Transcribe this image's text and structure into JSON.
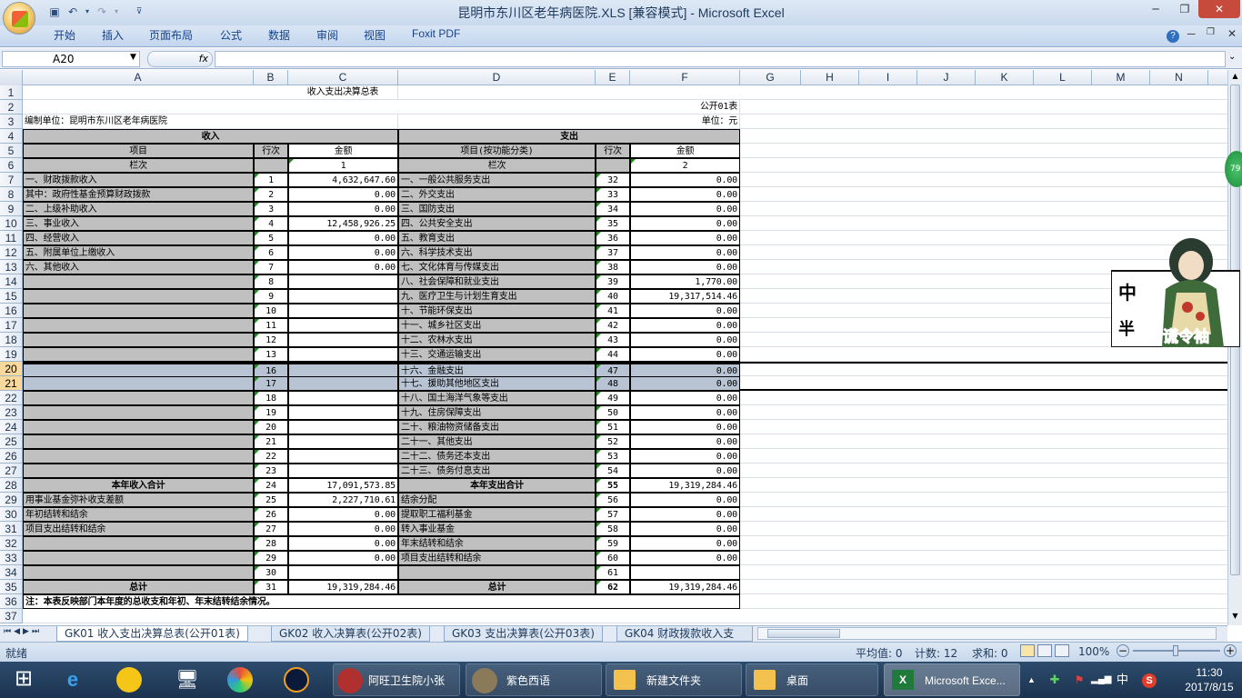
{
  "window": {
    "title": "昆明市东川区老年病医院.XLS  [兼容模式] - Microsoft Excel"
  },
  "ribbon": {
    "tabs": [
      "开始",
      "插入",
      "页面布局",
      "公式",
      "数据",
      "审阅",
      "视图",
      "Foxit PDF"
    ]
  },
  "formula_bar": {
    "name_box": "A20",
    "fx": "fx",
    "content": ""
  },
  "columns": [
    "A",
    "B",
    "C",
    "D",
    "E",
    "F",
    "G",
    "H",
    "I",
    "J",
    "K",
    "L",
    "M",
    "N"
  ],
  "sheet": {
    "title": "收入支出决算总表",
    "form_no": "公开01表",
    "unit_label": "单位：元",
    "org": "编制单位：昆明市东川区老年病医院",
    "income_header": "收入",
    "expense_header": "支出",
    "col_item": "项目",
    "col_line": "行次",
    "col_amount": "金额",
    "col_item_func": "项目(按功能分类)",
    "col_lanci": "栏次",
    "col_num1": "1",
    "col_num2": "2",
    "rows": [
      {
        "a": "一、财政拨款收入",
        "b": "1",
        "c": "4,632,647.60",
        "d": "一、一般公共服务支出",
        "e": "32",
        "f": "0.00"
      },
      {
        "a": "   其中：政府性基金预算财政拨款",
        "b": "2",
        "c": "0.00",
        "d": "二、外交支出",
        "e": "33",
        "f": "0.00"
      },
      {
        "a": "二、上级补助收入",
        "b": "3",
        "c": "0.00",
        "d": "三、国防支出",
        "e": "34",
        "f": "0.00"
      },
      {
        "a": "三、事业收入",
        "b": "4",
        "c": "12,458,926.25",
        "d": "四、公共安全支出",
        "e": "35",
        "f": "0.00"
      },
      {
        "a": "四、经营收入",
        "b": "5",
        "c": "0.00",
        "d": "五、教育支出",
        "e": "36",
        "f": "0.00"
      },
      {
        "a": "五、附属单位上缴收入",
        "b": "6",
        "c": "0.00",
        "d": "六、科学技术支出",
        "e": "37",
        "f": "0.00"
      },
      {
        "a": "六、其他收入",
        "b": "7",
        "c": "0.00",
        "d": "七、文化体育与传媒支出",
        "e": "38",
        "f": "0.00"
      },
      {
        "a": "",
        "b": "8",
        "c": "",
        "d": "八、社会保障和就业支出",
        "e": "39",
        "f": "1,770.00"
      },
      {
        "a": "",
        "b": "9",
        "c": "",
        "d": "九、医疗卫生与计划生育支出",
        "e": "40",
        "f": "19,317,514.46"
      },
      {
        "a": "",
        "b": "10",
        "c": "",
        "d": "十、节能环保支出",
        "e": "41",
        "f": "0.00"
      },
      {
        "a": "",
        "b": "11",
        "c": "",
        "d": "十一、城乡社区支出",
        "e": "42",
        "f": "0.00"
      },
      {
        "a": "",
        "b": "12",
        "c": "",
        "d": "十二、农林水支出",
        "e": "43",
        "f": "0.00"
      },
      {
        "a": "",
        "b": "13",
        "c": "",
        "d": "十三、交通运输支出",
        "e": "44",
        "f": "0.00"
      },
      {
        "a": "",
        "b": "16",
        "c": "",
        "d": "十六、金融支出",
        "e": "47",
        "f": "0.00"
      },
      {
        "a": "",
        "b": "17",
        "c": "",
        "d": "十七、援助其他地区支出",
        "e": "48",
        "f": "0.00"
      },
      {
        "a": "",
        "b": "18",
        "c": "",
        "d": "十八、国土海洋气象等支出",
        "e": "49",
        "f": "0.00"
      },
      {
        "a": "",
        "b": "19",
        "c": "",
        "d": "十九、住房保障支出",
        "e": "50",
        "f": "0.00"
      },
      {
        "a": "",
        "b": "20",
        "c": "",
        "d": "二十、粮油物资储备支出",
        "e": "51",
        "f": "0.00"
      },
      {
        "a": "",
        "b": "21",
        "c": "",
        "d": "二十一、其他支出",
        "e": "52",
        "f": "0.00"
      },
      {
        "a": "",
        "b": "22",
        "c": "",
        "d": "二十二、债务还本支出",
        "e": "53",
        "f": "0.00"
      },
      {
        "a": "",
        "b": "23",
        "c": "",
        "d": "二十三、债务付息支出",
        "e": "54",
        "f": "0.00"
      },
      {
        "a": "本年收入合计",
        "b": "24",
        "c": "17,091,573.85",
        "d": "本年支出合计",
        "e": "55",
        "f": "19,319,284.46",
        "bold": true
      },
      {
        "a": "    用事业基金弥补收支差额",
        "b": "25",
        "c": "2,227,710.61",
        "d": "     结余分配",
        "e": "56",
        "f": "0.00"
      },
      {
        "a": "    年初结转和结余",
        "b": "26",
        "c": "0.00",
        "d": "       提取职工福利基金",
        "e": "57",
        "f": "0.00"
      },
      {
        "a": "      项目支出结转和结余",
        "b": "27",
        "c": "0.00",
        "d": "       转入事业基金",
        "e": "58",
        "f": "0.00"
      },
      {
        "a": "",
        "b": "28",
        "c": "0.00",
        "d": "     年末结转和结余",
        "e": "59",
        "f": "0.00"
      },
      {
        "a": "",
        "b": "29",
        "c": "0.00",
        "d": "       项目支出结转和结余",
        "e": "60",
        "f": "0.00"
      },
      {
        "a": "",
        "b": "30",
        "c": "",
        "d": "",
        "e": "61",
        "f": ""
      },
      {
        "a": "总计",
        "b": "31",
        "c": "19,319,284.46",
        "d": "总计",
        "e": "62",
        "f": "19,319,284.46",
        "bold": true
      }
    ],
    "note": "注：本表反映部门本年度的总收支和年初、年末结转结余情况。"
  },
  "row_numbers": [
    "1",
    "2",
    "3",
    "4",
    "5",
    "6",
    "7",
    "8",
    "9",
    "10",
    "11",
    "12",
    "13",
    "14",
    "15",
    "16",
    "17",
    "18",
    "19",
    "20",
    "21",
    "22",
    "23",
    "24",
    "25",
    "26",
    "27",
    "28",
    "29",
    "30",
    "31",
    "32",
    "33",
    "34",
    "35",
    "36",
    "37"
  ],
  "sheet_tabs": [
    "GK01 收入支出决算总表(公开01表)",
    "GK02 收入决算表(公开02表)",
    "GK03 支出决算表(公开03表)",
    "GK04 财政拨款收入支"
  ],
  "status": {
    "ready": "就绪",
    "avg": "平均值: 0",
    "count": "计数: 12",
    "sum": "求和: 0",
    "zoom": "100%"
  },
  "taskbar": {
    "items": [
      "阿旺卫生院小张",
      "紫色西语",
      "新建文件夹",
      "桌面",
      "Microsoft Exce..."
    ],
    "time": "11:30",
    "date": "2017/8/15",
    "ime": "中"
  },
  "sticker": {
    "text1": "中",
    "text2": "半",
    "text3": "嗜谎令袖"
  },
  "badge": "79"
}
